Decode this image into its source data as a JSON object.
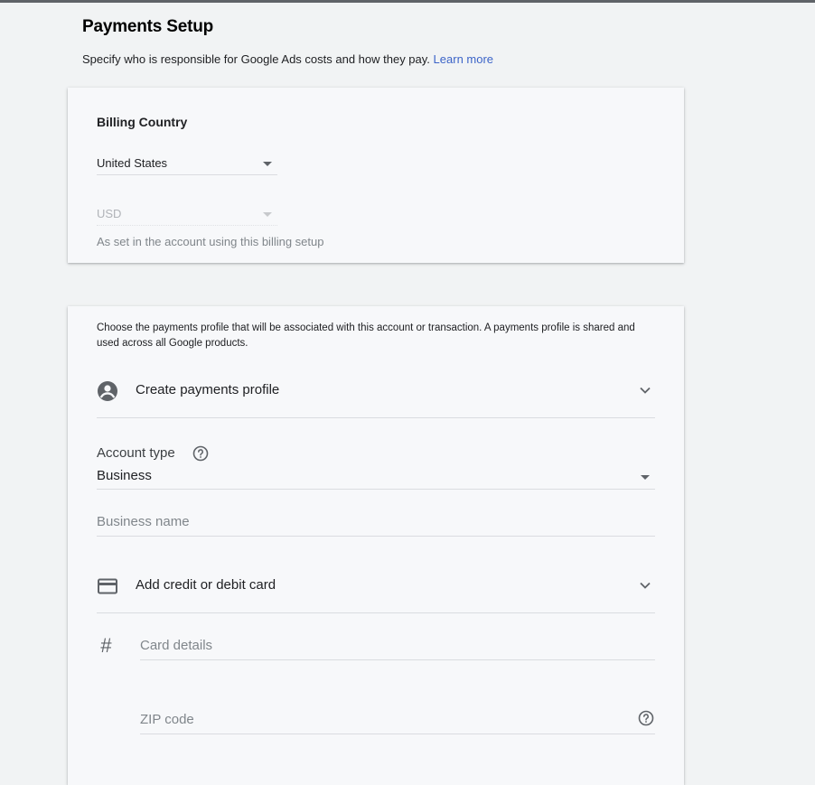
{
  "header": {
    "title": "Payments Setup",
    "subtitle": "Specify who is responsible for Google Ads costs and how they pay.",
    "learn_more": "Learn more"
  },
  "billing_country": {
    "title": "Billing Country",
    "country_value": "United States",
    "currency_value": "USD",
    "currency_hint": "As set in the account using this billing setup"
  },
  "payments_profile": {
    "description": "Choose the payments profile that will be associated with this account or transaction. A payments profile is shared and used across all Google products.",
    "create_profile_label": "Create payments profile",
    "account_type_label": "Account type",
    "account_type_value": "Business",
    "business_name_placeholder": "Business name",
    "add_card_label": "Add credit or debit card",
    "card_details_placeholder": "Card details",
    "zip_placeholder": "ZIP code",
    "card_number_glyph": "#"
  },
  "icons": {
    "profile": "account-circle-icon",
    "card": "credit-card-icon",
    "help": "help-circle-icon",
    "chevron": "chevron-down-icon",
    "hash": "hash-icon"
  },
  "colors": {
    "link": "#3c64c8",
    "background": "#f1f3f4",
    "card": "#f7f8fa",
    "icon": "#5f6368"
  }
}
